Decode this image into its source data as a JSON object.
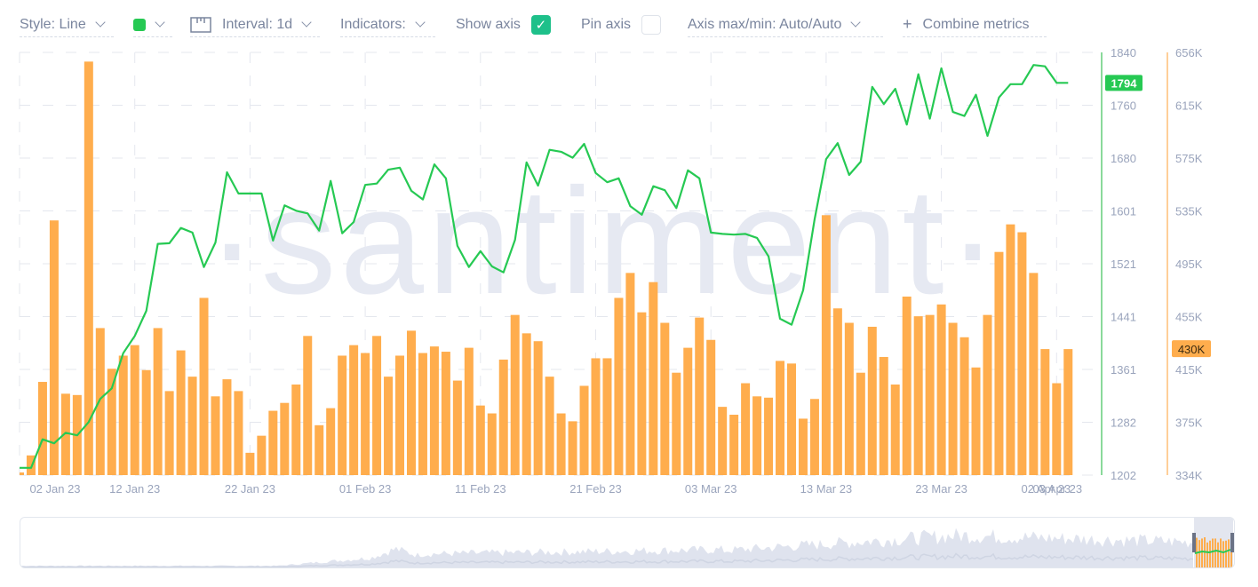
{
  "toolbar": {
    "style_label": "Style: Line",
    "color": "#26c953",
    "interval_label": "Interval: 1d",
    "indicators_label": "Indicators:",
    "show_axis_label": "Show axis",
    "show_axis_checked": true,
    "pin_axis_label": "Pin axis",
    "pin_axis_checked": false,
    "axis_maxmin_label": "Axis max/min: Auto/Auto",
    "combine_plus": "+",
    "combine_label": "Combine metrics"
  },
  "watermark": "·santiment·",
  "chart_data": {
    "type": "line+bar",
    "grid": true,
    "x": [
      "2023-01-02",
      "2023-01-03",
      "2023-01-04",
      "2023-01-05",
      "2023-01-06",
      "2023-01-07",
      "2023-01-08",
      "2023-01-09",
      "2023-01-10",
      "2023-01-11",
      "2023-01-12",
      "2023-01-13",
      "2023-01-14",
      "2023-01-15",
      "2023-01-16",
      "2023-01-17",
      "2023-01-18",
      "2023-01-19",
      "2023-01-20",
      "2023-01-21",
      "2023-01-22",
      "2023-01-23",
      "2023-01-24",
      "2023-01-25",
      "2023-01-26",
      "2023-01-27",
      "2023-01-28",
      "2023-01-29",
      "2023-01-30",
      "2023-01-31",
      "2023-02-01",
      "2023-02-02",
      "2023-02-03",
      "2023-02-04",
      "2023-02-05",
      "2023-02-06",
      "2023-02-07",
      "2023-02-08",
      "2023-02-09",
      "2023-02-10",
      "2023-02-11",
      "2023-02-12",
      "2023-02-13",
      "2023-02-14",
      "2023-02-15",
      "2023-02-16",
      "2023-02-17",
      "2023-02-18",
      "2023-02-19",
      "2023-02-20",
      "2023-02-21",
      "2023-02-22",
      "2023-02-23",
      "2023-02-24",
      "2023-02-25",
      "2023-02-26",
      "2023-02-27",
      "2023-02-28",
      "2023-03-01",
      "2023-03-02",
      "2023-03-03",
      "2023-03-04",
      "2023-03-05",
      "2023-03-06",
      "2023-03-07",
      "2023-03-08",
      "2023-03-09",
      "2023-03-10",
      "2023-03-11",
      "2023-03-12",
      "2023-03-13",
      "2023-03-14",
      "2023-03-15",
      "2023-03-16",
      "2023-03-17",
      "2023-03-18",
      "2023-03-19",
      "2023-03-20",
      "2023-03-21",
      "2023-03-22",
      "2023-03-23",
      "2023-03-24",
      "2023-03-25",
      "2023-03-26",
      "2023-03-27",
      "2023-03-28",
      "2023-03-29",
      "2023-03-30",
      "2023-03-31",
      "2023-04-01",
      "2023-04-02",
      "2023-04-03"
    ],
    "x_ticks": [
      {
        "date": "2023-01-02",
        "label": "02 Jan 23"
      },
      {
        "date": "2023-01-12",
        "label": "12 Jan 23"
      },
      {
        "date": "2023-01-22",
        "label": "22 Jan 23"
      },
      {
        "date": "2023-02-01",
        "label": "01 Feb 23"
      },
      {
        "date": "2023-02-11",
        "label": "11 Feb 23"
      },
      {
        "date": "2023-02-21",
        "label": "21 Feb 23"
      },
      {
        "date": "2023-03-03",
        "label": "03 Mar 23"
      },
      {
        "date": "2023-03-13",
        "label": "13 Mar 23"
      },
      {
        "date": "2023-03-23",
        "label": "23 Mar 23"
      },
      {
        "date": "2023-04-02",
        "label": "02 Apr 23"
      },
      {
        "date": "2023-04-03",
        "label": "03 Apr 23"
      }
    ],
    "series": [
      {
        "type": "line",
        "axis": "left",
        "color": "#26c953",
        "axis_color": "#8ad99a",
        "ylim": [
          1202,
          1840
        ],
        "y_ticks": [
          "1840",
          "1760",
          "1680",
          "1601",
          "1521",
          "1441",
          "1361",
          "1282",
          "1202"
        ],
        "last_value_label": "1794",
        "values": [
          1213,
          1213,
          1256,
          1250,
          1266,
          1262,
          1282,
          1317,
          1333,
          1386,
          1412,
          1450,
          1551,
          1552,
          1575,
          1568,
          1516,
          1553,
          1659,
          1627,
          1627,
          1627,
          1556,
          1609,
          1601,
          1597,
          1571,
          1646,
          1567,
          1584,
          1640,
          1642,
          1663,
          1666,
          1631,
          1618,
          1671,
          1650,
          1548,
          1516,
          1540,
          1517,
          1508,
          1557,
          1674,
          1639,
          1693,
          1690,
          1681,
          1702,
          1658,
          1644,
          1650,
          1608,
          1595,
          1638,
          1632,
          1605,
          1662,
          1650,
          1568,
          1566,
          1565,
          1566,
          1560,
          1532,
          1438,
          1429,
          1481,
          1588,
          1679,
          1703,
          1655,
          1675,
          1788,
          1762,
          1785,
          1731,
          1807,
          1740,
          1816,
          1750,
          1744,
          1776,
          1714,
          1772,
          1792,
          1792,
          1821,
          1819,
          1794,
          1794
        ]
      },
      {
        "type": "bar",
        "axis": "right",
        "color": "#ffad4d",
        "axis_color": "#ffcf99",
        "ylim": [
          334,
          656
        ],
        "unit": "K",
        "y_ticks": [
          "656K",
          "615K",
          "575K",
          "535K",
          "495K",
          "455K",
          "415K",
          "375K",
          "334K"
        ],
        "last_value_label": "430K",
        "values": [
          336,
          349,
          405,
          528,
          396,
          395,
          649,
          446,
          415,
          425,
          433,
          414,
          446,
          398,
          429,
          409,
          469,
          394,
          407,
          398,
          351,
          364,
          383,
          389,
          403,
          440,
          372,
          385,
          425,
          433,
          427,
          440,
          409,
          425,
          444,
          427,
          432,
          428,
          406,
          431,
          387,
          381,
          422,
          456,
          442,
          436,
          409,
          381,
          375,
          402,
          423,
          423,
          469,
          488,
          458,
          481,
          450,
          412,
          431,
          454,
          437,
          386,
          380,
          404,
          394,
          393,
          421,
          419,
          377,
          392,
          532,
          461,
          450,
          412,
          447,
          424,
          403,
          470,
          455,
          456,
          464,
          450,
          439,
          416,
          456,
          504,
          525,
          519,
          488,
          430,
          404,
          430
        ]
      }
    ]
  }
}
